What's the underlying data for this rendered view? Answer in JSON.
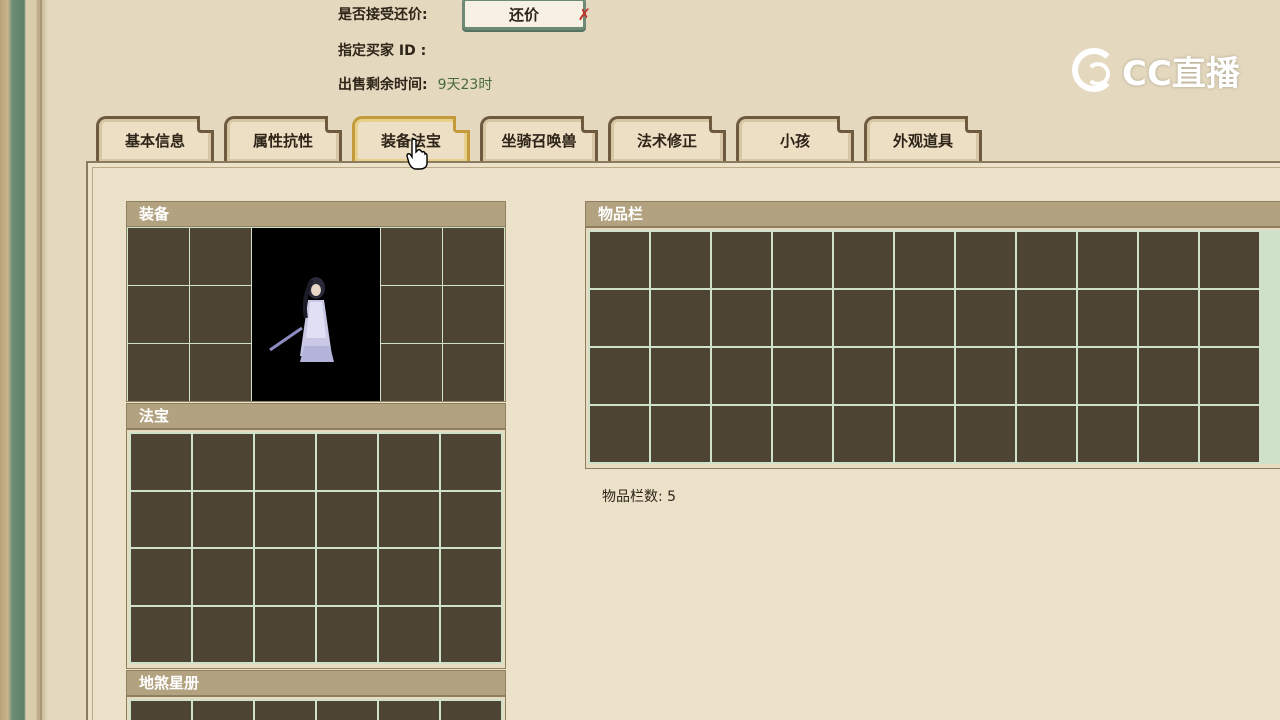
{
  "info": {
    "bargain_label": "是否接受还价:",
    "bargain_button": "还价",
    "buyer_label": "指定买家 ID :",
    "time_label": "出售剩余时间:",
    "time_value": "9天23时"
  },
  "logo": {
    "text": "CC直播",
    "icon": "cc-swirl-icon"
  },
  "tabs": [
    {
      "label": "基本信息",
      "active": false
    },
    {
      "label": "属性抗性",
      "active": false
    },
    {
      "label": "装备法宝",
      "active": true
    },
    {
      "label": "坐骑召唤兽",
      "active": false
    },
    {
      "label": "法术修正",
      "active": false
    },
    {
      "label": "小孩",
      "active": false
    },
    {
      "label": "外观道具",
      "active": false
    }
  ],
  "sections": {
    "equipment": "装备",
    "treasure": "法宝",
    "star_book": "地煞星册",
    "inventory": "物品栏"
  },
  "inventory_count_label": "物品栏数:",
  "inventory_count_value": "5",
  "colors": {
    "background": "#e4d9be",
    "cell": "#4e4434",
    "section_header": "#b2a280",
    "active_tab_border": "#c49a3a"
  }
}
